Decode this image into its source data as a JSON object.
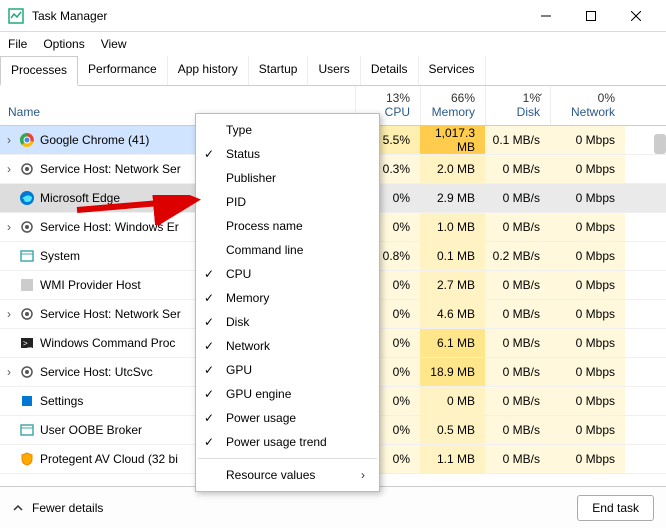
{
  "window": {
    "title": "Task Manager"
  },
  "menu": {
    "file": "File",
    "options": "Options",
    "view": "View"
  },
  "tabs": [
    "Processes",
    "Performance",
    "App history",
    "Startup",
    "Users",
    "Details",
    "Services"
  ],
  "headers": {
    "name": "Name",
    "cols": [
      {
        "pct": "13%",
        "label": "CPU"
      },
      {
        "pct": "66%",
        "label": "Memory"
      },
      {
        "pct": "1%",
        "label": "Disk"
      },
      {
        "pct": "0%",
        "label": "Network"
      }
    ]
  },
  "rows": [
    {
      "exp": true,
      "name": "Google Chrome (41)",
      "cpu": "5.5%",
      "mem": "1,017.3 MB",
      "disk": "0.1 MB/s",
      "net": "0 Mbps",
      "icon": "chrome"
    },
    {
      "exp": true,
      "name": "Service Host: Network Ser",
      "cpu": "0.3%",
      "mem": "2.0 MB",
      "disk": "0 MB/s",
      "net": "0 Mbps",
      "icon": "gear"
    },
    {
      "exp": false,
      "name": "Microsoft Edge",
      "cpu": "0%",
      "mem": "2.9 MB",
      "disk": "0 MB/s",
      "net": "0 Mbps",
      "icon": "edge",
      "selected": true
    },
    {
      "exp": true,
      "name": "Service Host: Windows Er",
      "cpu": "0%",
      "mem": "1.0 MB",
      "disk": "0 MB/s",
      "net": "0 Mbps",
      "icon": "gear"
    },
    {
      "exp": false,
      "name": "System",
      "cpu": "0.8%",
      "mem": "0.1 MB",
      "disk": "0.2 MB/s",
      "net": "0 Mbps",
      "icon": "window"
    },
    {
      "exp": false,
      "name": "WMI Provider Host",
      "cpu": "0%",
      "mem": "2.7 MB",
      "disk": "0 MB/s",
      "net": "0 Mbps",
      "icon": "app"
    },
    {
      "exp": true,
      "name": "Service Host: Network Ser",
      "cpu": "0%",
      "mem": "4.6 MB",
      "disk": "0 MB/s",
      "net": "0 Mbps",
      "icon": "gear"
    },
    {
      "exp": false,
      "name": "Windows Command Proc",
      "cpu": "0%",
      "mem": "6.1 MB",
      "disk": "0 MB/s",
      "net": "0 Mbps",
      "icon": "cmd"
    },
    {
      "exp": true,
      "name": "Service Host: UtcSvc",
      "cpu": "0%",
      "mem": "18.9 MB",
      "disk": "0 MB/s",
      "net": "0 Mbps",
      "icon": "gear"
    },
    {
      "exp": false,
      "name": "Settings",
      "cpu": "0%",
      "mem": "0 MB",
      "disk": "0 MB/s",
      "net": "0 Mbps",
      "icon": "settings"
    },
    {
      "exp": false,
      "name": "User OOBE Broker",
      "cpu": "0%",
      "mem": "0.5 MB",
      "disk": "0 MB/s",
      "net": "0 Mbps",
      "icon": "window"
    },
    {
      "exp": false,
      "name": "Protegent AV Cloud (32 bi",
      "cpu": "0%",
      "mem": "1.1 MB",
      "disk": "0 MB/s",
      "net": "0 Mbps",
      "icon": "shield"
    }
  ],
  "context_menu": [
    {
      "label": "Type",
      "checked": false
    },
    {
      "label": "Status",
      "checked": true
    },
    {
      "label": "Publisher",
      "checked": false
    },
    {
      "label": "PID",
      "checked": false
    },
    {
      "label": "Process name",
      "checked": false
    },
    {
      "label": "Command line",
      "checked": false
    },
    {
      "label": "CPU",
      "checked": true
    },
    {
      "label": "Memory",
      "checked": true
    },
    {
      "label": "Disk",
      "checked": true
    },
    {
      "label": "Network",
      "checked": true
    },
    {
      "label": "GPU",
      "checked": true
    },
    {
      "label": "GPU engine",
      "checked": true
    },
    {
      "label": "Power usage",
      "checked": true
    },
    {
      "label": "Power usage trend",
      "checked": true
    }
  ],
  "context_menu_footer": "Resource values",
  "footer": {
    "fewer": "Fewer details",
    "end": "End task"
  }
}
